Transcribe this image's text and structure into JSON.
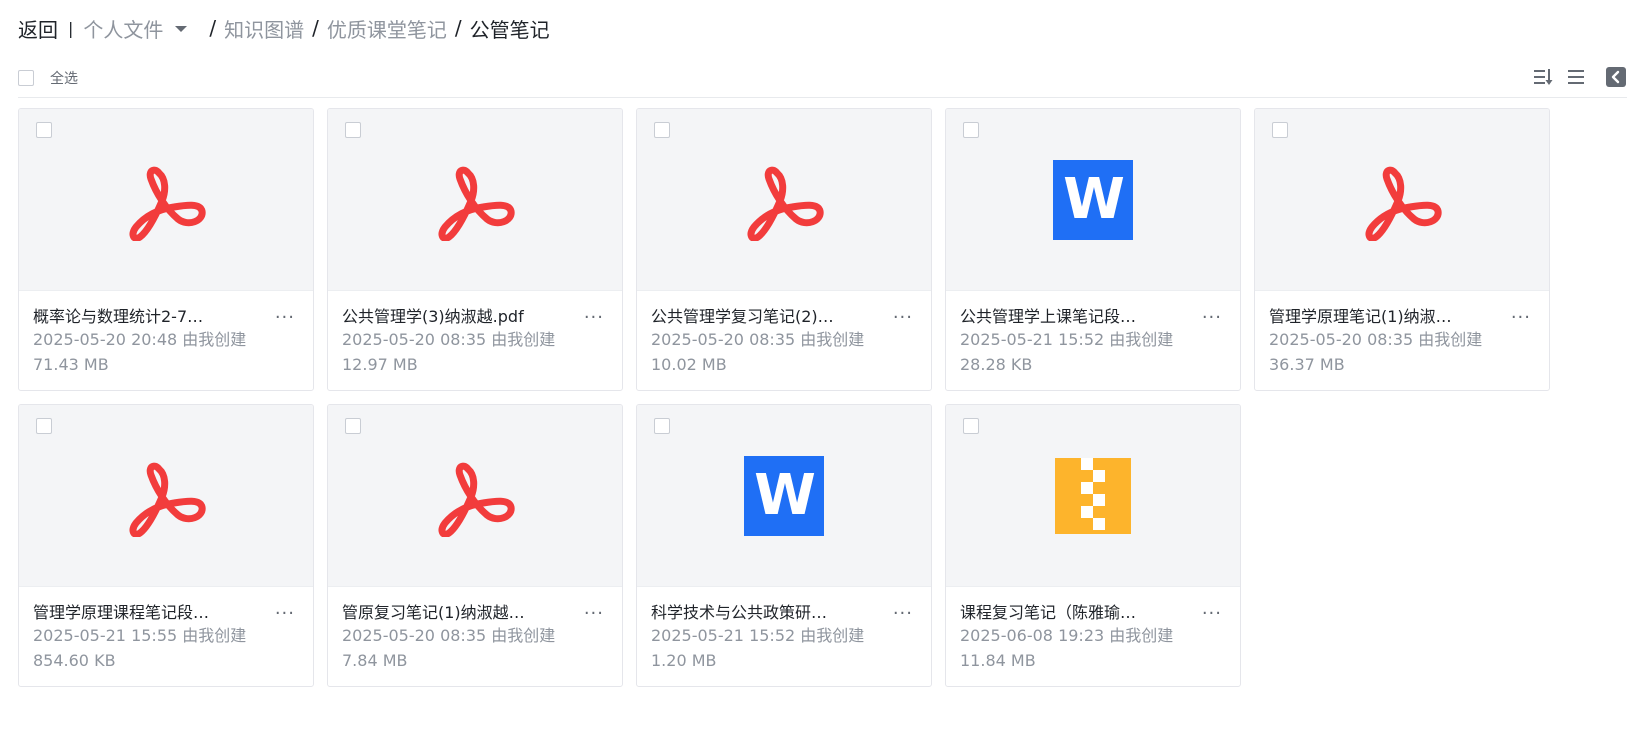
{
  "breadcrumb": {
    "back": "返回",
    "separator_bar": "|",
    "root": "个人文件",
    "items": [
      "知识图谱",
      "优质课堂笔记"
    ],
    "current": "公管笔记",
    "sep": "/"
  },
  "toolbar": {
    "select_all": "全选",
    "icons": [
      "sort-icon",
      "list-view-icon",
      "collapse-panel-icon"
    ]
  },
  "colors": {
    "pdf": "#f23c3c",
    "word": "#1f6ff5",
    "zip": "#fdb42c"
  },
  "files": [
    {
      "name": "概率论与数理统计2-7…",
      "meta": "2025-05-20 20:48 由我创建",
      "size": "71.43 MB",
      "type": "pdf"
    },
    {
      "name": "公共管理学(3)纳淑越.pdf",
      "meta": "2025-05-20 08:35 由我创建",
      "size": "12.97 MB",
      "type": "pdf"
    },
    {
      "name": "公共管理学复习笔记(2)…",
      "meta": "2025-05-20 08:35 由我创建",
      "size": "10.02 MB",
      "type": "pdf"
    },
    {
      "name": "公共管理学上课笔记段…",
      "meta": "2025-05-21 15:52 由我创建",
      "size": "28.28 KB",
      "type": "word"
    },
    {
      "name": "管理学原理笔记(1)纳淑…",
      "meta": "2025-05-20 08:35 由我创建",
      "size": "36.37 MB",
      "type": "pdf"
    },
    {
      "name": "管理学原理课程笔记段…",
      "meta": "2025-05-21 15:55 由我创建",
      "size": "854.60 KB",
      "type": "pdf"
    },
    {
      "name": "管原复习笔记(1)纳淑越…",
      "meta": "2025-05-20 08:35 由我创建",
      "size": "7.84 MB",
      "type": "pdf"
    },
    {
      "name": "科学技术与公共政策研…",
      "meta": "2025-05-21 15:52 由我创建",
      "size": "1.20 MB",
      "type": "word"
    },
    {
      "name": "课程复习笔记（陈雅瑜…",
      "meta": "2025-06-08 19:23 由我创建",
      "size": "11.84 MB",
      "type": "zip"
    }
  ],
  "labels": {
    "more": "···",
    "word_letter": "W"
  }
}
